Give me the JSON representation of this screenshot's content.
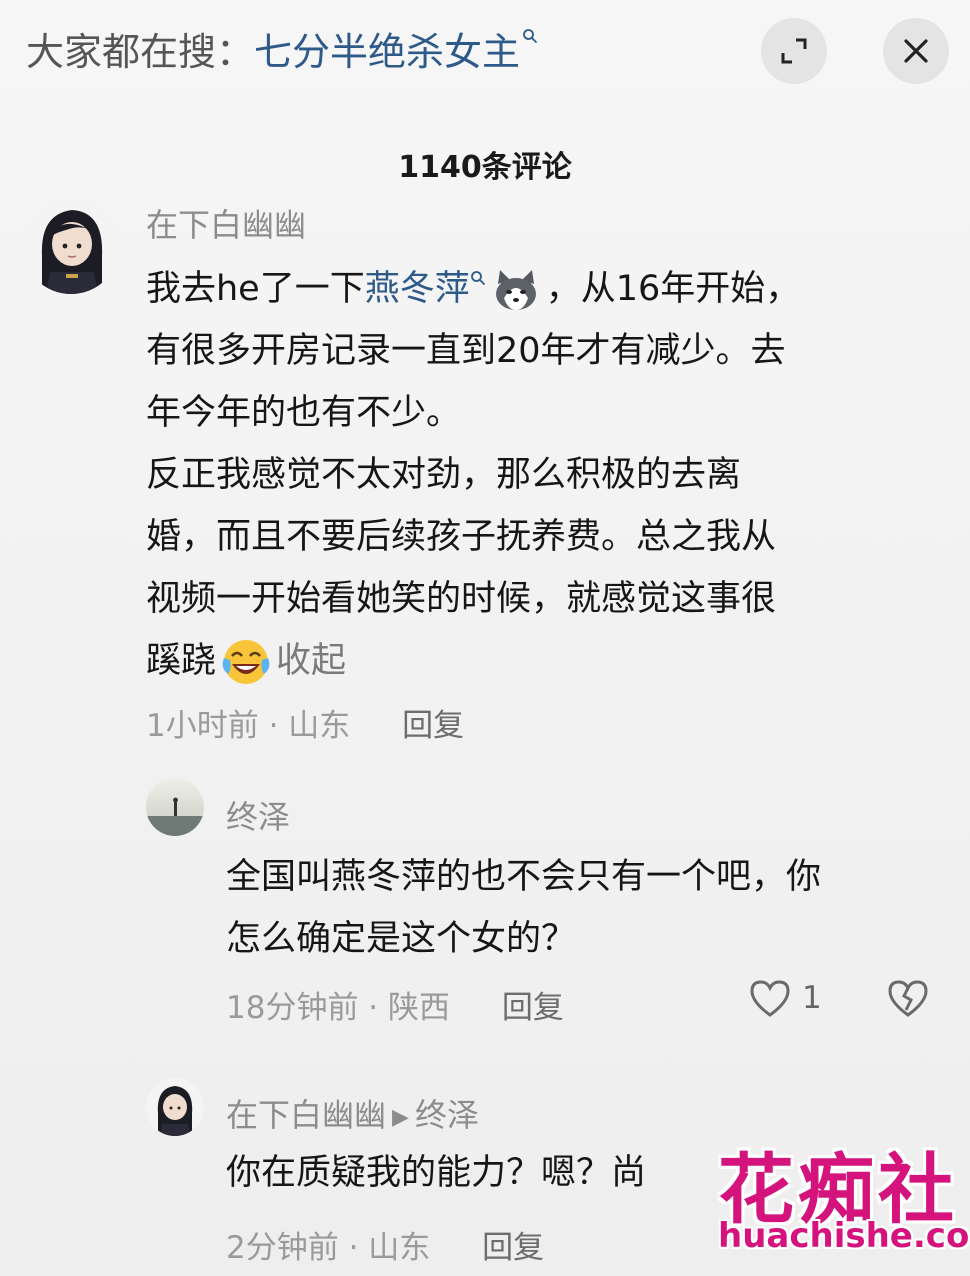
{
  "search_bar": {
    "prefix": "大家都在搜：",
    "term": "七分半绝杀女主"
  },
  "header": {
    "title": "1140条评论"
  },
  "icons": {
    "expand": "expand-icon",
    "close": "close-icon",
    "search_hint": "search-hint-icon",
    "heart": "heart-icon",
    "dislike": "broken-heart-icon"
  },
  "colors": {
    "link": "#2e5a8a",
    "watermark": "#d5137c",
    "background": "#f2f2f2"
  },
  "comments": [
    {
      "username": "在下白幽幽",
      "text_part1": "我去he了一下",
      "link": "燕冬萍",
      "text_part2": "，从16年开始，",
      "lines": [
        "有很多开房记录一直到20年才有减少。去",
        "年今年的也有不少。",
        "反正我感觉不太对劲，那么积极的去离",
        "婚，而且不要后续孩子抚养费。总之我从",
        "视频一开始看她笑的时候，就感觉这事很"
      ],
      "last_line": "蹊跷",
      "emoji": "laughing-crying-emoji",
      "collapse_label": "收起",
      "time_location": "1小时前 · 山东",
      "reply_label": "回复"
    },
    {
      "username": "终泽",
      "lines": [
        "全国叫燕冬萍的也不会只有一个吧，你",
        "怎么确定是这个女的？"
      ],
      "time_location": "18分钟前 · 陕西",
      "reply_label": "回复",
      "likes": "1"
    },
    {
      "username": "在下白幽幽",
      "reply_to": "终泽",
      "lines": [
        "你在质疑我的能力？嗯？尚"
      ],
      "time_location": "2分钟前 · 山东",
      "reply_label": "回复"
    }
  ],
  "watermark": {
    "cn": "花痴社",
    "en": "huachishe.com"
  }
}
